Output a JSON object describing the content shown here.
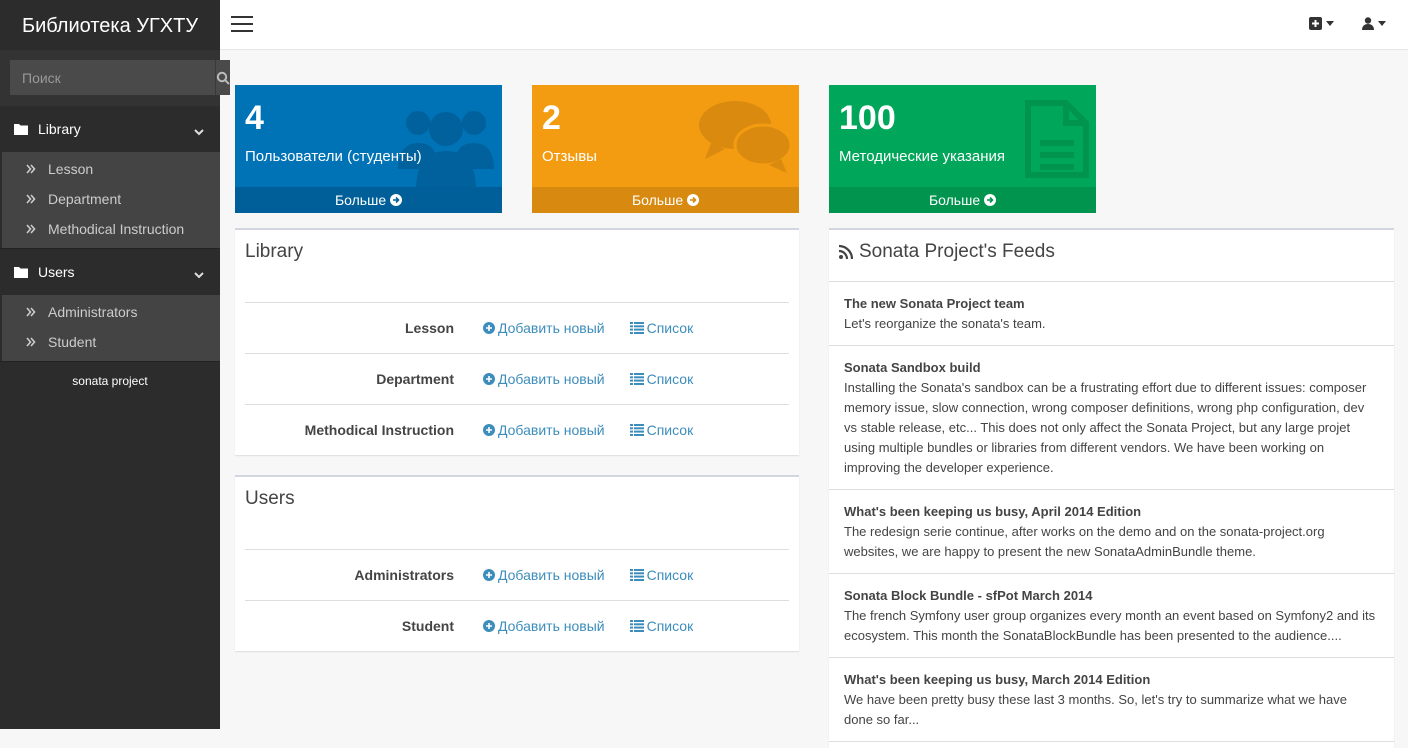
{
  "sidebar": {
    "brand": "Библиотека УГХТУ",
    "search_placeholder": "Поиск",
    "groups": [
      {
        "label": "Library",
        "items": [
          "Lesson",
          "Department",
          "Methodical Instruction"
        ]
      },
      {
        "label": "Users",
        "items": [
          "Administrators",
          "Student"
        ]
      }
    ],
    "footer": "sonata project"
  },
  "stats": [
    {
      "number": "4",
      "label": "Пользователи (студенты)",
      "more": "Больше",
      "color": "#0073b7",
      "icon": "users-icon"
    },
    {
      "number": "2",
      "label": "Отзывы",
      "more": "Больше",
      "color": "#f39c12",
      "icon": "comments-icon"
    },
    {
      "number": "100",
      "label": "Методические указания",
      "more": "Больше",
      "color": "#00a65a",
      "icon": "file-text-icon"
    }
  ],
  "panels": {
    "library": {
      "title": "Library",
      "rows": [
        {
          "label": "Lesson",
          "add": "Добавить новый",
          "list": "Список"
        },
        {
          "label": "Department",
          "add": "Добавить новый",
          "list": "Список"
        },
        {
          "label": "Methodical Instruction",
          "add": "Добавить новый",
          "list": "Список"
        }
      ]
    },
    "users": {
      "title": "Users",
      "rows": [
        {
          "label": "Administrators",
          "add": "Добавить новый",
          "list": "Список"
        },
        {
          "label": "Student",
          "add": "Добавить новый",
          "list": "Список"
        }
      ]
    }
  },
  "feeds": {
    "title": "Sonata Project's Feeds",
    "items": [
      {
        "title": "The new Sonata Project team",
        "body": "Let's reorganize the sonata's team."
      },
      {
        "title": "Sonata Sandbox build",
        "body": "Installing the Sonata's sandbox can be a frustrating effort due to different issues: composer memory issue, slow connection, wrong composer definitions, wrong php configuration, dev vs stable release, etc... This does not only affect the Sonata Project, but any large projet using multiple bundles or libraries from different vendors. We have been working on improving the developer experience."
      },
      {
        "title": "What's been keeping us busy, April 2014 Edition",
        "body": "The redesign serie continue, after works on the demo and on the sonata-project.org websites, we are happy to present the new SonataAdminBundle theme."
      },
      {
        "title": "Sonata Block Bundle - sfPot March 2014",
        "body": "The french Symfony user group organizes every month an event based on Symfony2 and its ecosystem. This month the SonataBlockBundle has been presented to the audience...."
      },
      {
        "title": "What's been keeping us busy, March 2014 Edition",
        "body": "We have been pretty busy these last 3 months. So, let's try to summarize what we have done so far..."
      }
    ]
  },
  "colors": {
    "link": "#3c8dbc",
    "sidebar_bg": "#2c2c2c"
  }
}
